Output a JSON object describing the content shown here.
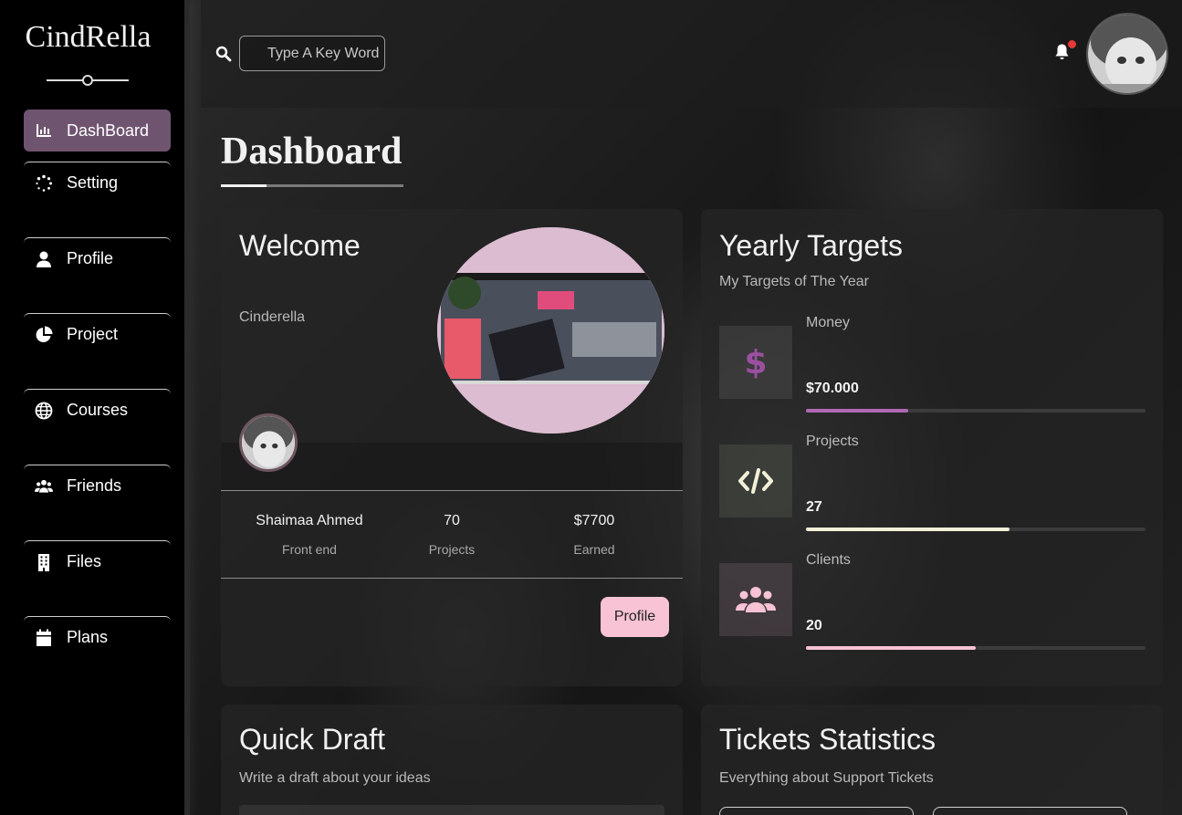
{
  "brand": {
    "name": "CindRella"
  },
  "sidebar": {
    "items": [
      {
        "label": "DashBoard",
        "icon": "chart-bar-icon",
        "active": true
      },
      {
        "label": "Setting",
        "icon": "spinner-icon"
      },
      {
        "label": "Profile",
        "icon": "user-icon"
      },
      {
        "label": "Project",
        "icon": "pie-chart-icon"
      },
      {
        "label": "Courses",
        "icon": "globe-icon"
      },
      {
        "label": "Friends",
        "icon": "users-icon"
      },
      {
        "label": "Files",
        "icon": "building-icon"
      },
      {
        "label": "Plans",
        "icon": "calendar-icon"
      }
    ]
  },
  "header": {
    "search": {
      "placeholder": "Type A Key Word"
    },
    "notifications": {
      "icon": "bell-icon",
      "badge_color": "#e53935"
    }
  },
  "page": {
    "title": "Dashboard"
  },
  "welcome": {
    "title": "Welcome",
    "subtitle": "Cinderella",
    "stats": [
      {
        "value": "Shaimaa Ahmed",
        "label": "Front end"
      },
      {
        "value": "70",
        "label": "Projects"
      },
      {
        "value": "$7700",
        "label": "Earned"
      }
    ],
    "button": "Profile"
  },
  "targets": {
    "title": "Yearly Targets",
    "subtitle": "My Targets of The Year",
    "items": [
      {
        "label": "Money",
        "value": "$70.000",
        "progress": 0.3,
        "color": "#b06ab3",
        "icon": "dollar-icon"
      },
      {
        "label": "Projects",
        "value": "27",
        "progress": 0.6,
        "color": "#f3f0d8",
        "icon": "code-icon"
      },
      {
        "label": "Clients",
        "value": "20",
        "progress": 0.5,
        "color": "#f8c3d4",
        "icon": "users-icon"
      }
    ]
  },
  "draft": {
    "title": "Quick Draft",
    "subtitle": "Write a draft about your ideas"
  },
  "tickets": {
    "title": "Tickets Statistics",
    "subtitle": "Everything about Support Tickets"
  },
  "colors": {
    "accent": "#6f5470",
    "button": "#f8c3d4"
  }
}
